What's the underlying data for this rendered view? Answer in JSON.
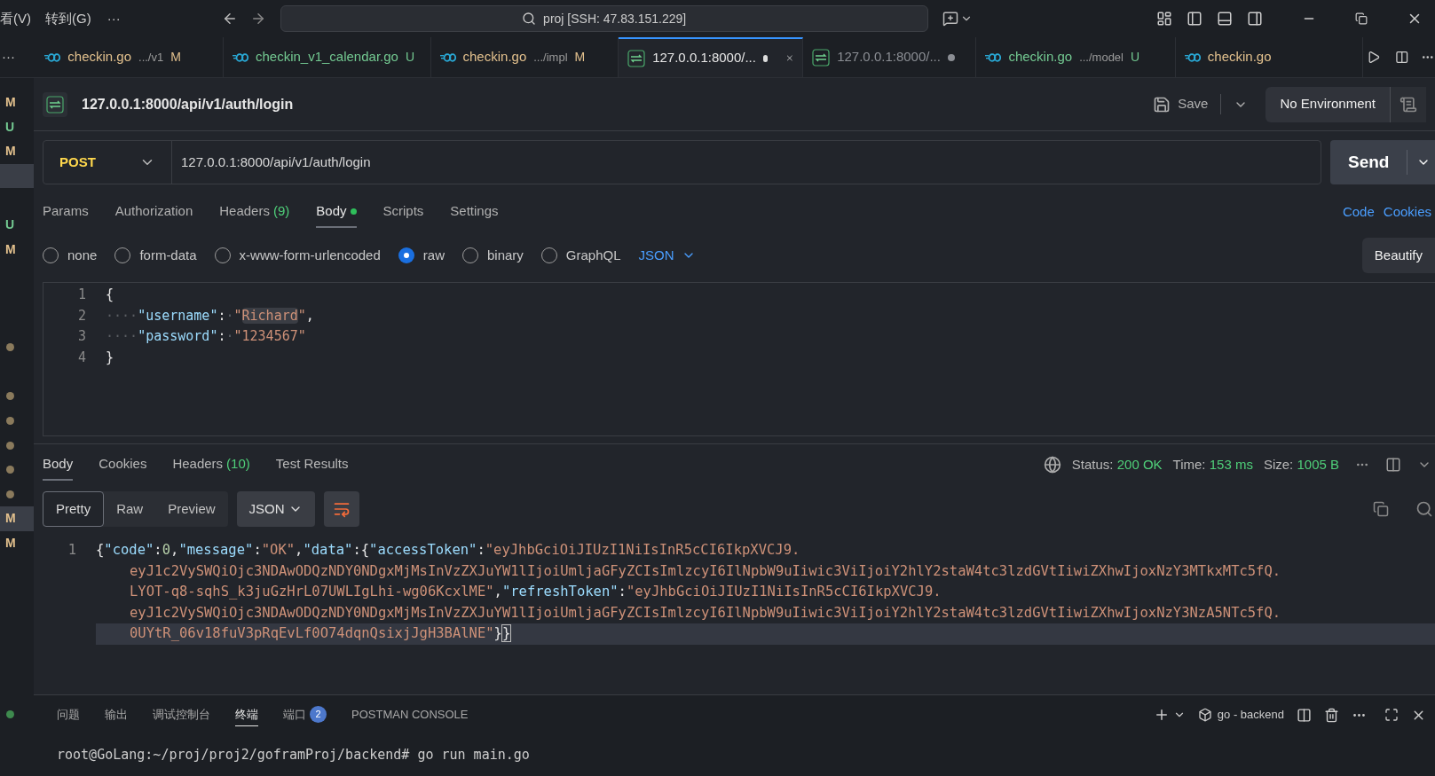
{
  "title_bar": {
    "menus": [
      "看(V)",
      "转到(G)"
    ],
    "more": "···",
    "search": "proj [SSH: 47.83.151.229]"
  },
  "editor_tabs": {
    "more": "···",
    "tabs": [
      {
        "kind": "go",
        "name": "checkin.go",
        "path": ".../v1",
        "status": "M",
        "color": "#e2c08d",
        "dirty": false,
        "selected": false
      },
      {
        "kind": "go",
        "name": "checkin_v1_calendar.go",
        "status": "U",
        "color": "#73c991",
        "dirty": false,
        "selected": false
      },
      {
        "kind": "go",
        "name": "checkin.go",
        "path": ".../impl",
        "status": "M",
        "color": "#e2c08d",
        "dirty": false,
        "selected": false
      },
      {
        "kind": "http",
        "name": "127.0.0.1:8000/...",
        "color": "#e6e6e6",
        "dirty": true,
        "selected": true
      },
      {
        "kind": "http",
        "name": "127.0.0.1:8000/...",
        "color": "#8b8e94",
        "dirty": true,
        "selected": false
      },
      {
        "kind": "go",
        "name": "checkin.go",
        "path": ".../model",
        "status": "U",
        "color": "#73c991",
        "dirty": false,
        "selected": false
      },
      {
        "kind": "go",
        "name": "checkin.go",
        "color": "#e2c08d",
        "dirty": false,
        "selected": false
      }
    ]
  },
  "gutter": [
    {
      "kind": "letter",
      "text": "M",
      "color": "#e2c08d",
      "selected": false
    },
    {
      "kind": "letter",
      "text": "U",
      "color": "#73c991",
      "selected": false
    },
    {
      "kind": "letter",
      "text": "M",
      "color": "#e2c08d",
      "selected": false
    },
    {
      "kind": "empty",
      "selected": true
    },
    {
      "kind": "empty",
      "selected": false
    },
    {
      "kind": "letter",
      "text": "U",
      "color": "#73c991",
      "selected": false
    },
    {
      "kind": "letter",
      "text": "M",
      "color": "#e2c08d",
      "selected": false
    },
    {
      "kind": "empty",
      "selected": false
    },
    {
      "kind": "empty",
      "selected": false
    },
    {
      "kind": "empty",
      "selected": false
    },
    {
      "kind": "dot",
      "color": "#8a7a5c",
      "selected": false
    },
    {
      "kind": "empty",
      "selected": false
    },
    {
      "kind": "dot",
      "color": "#8a7a5c",
      "selected": false
    },
    {
      "kind": "dot",
      "color": "#8a7a5c",
      "selected": false
    },
    {
      "kind": "dot",
      "color": "#8a7a5c",
      "selected": false
    },
    {
      "kind": "dot",
      "color": "#8a7a5c",
      "selected": false
    },
    {
      "kind": "dot",
      "color": "#8a7a5c",
      "selected": false
    },
    {
      "kind": "letter",
      "text": "M",
      "color": "#e2c08d",
      "selected": true
    },
    {
      "kind": "letter",
      "text": "M",
      "color": "#e2c08d",
      "selected": false
    },
    {
      "kind": "empty",
      "selected": false
    },
    {
      "kind": "empty",
      "selected": false
    },
    {
      "kind": "empty",
      "selected": false
    },
    {
      "kind": "empty",
      "selected": false
    },
    {
      "kind": "empty",
      "selected": false
    },
    {
      "kind": "empty",
      "selected": false
    },
    {
      "kind": "dot",
      "color": "#3e8a4e",
      "selected": false
    }
  ],
  "request": {
    "title": "127.0.0.1:8000/api/v1/auth/login",
    "save": "Save",
    "environment": "No Environment",
    "method": "POST",
    "url": "127.0.0.1:8000/api/v1/auth/login",
    "send": "Send",
    "tabs": [
      {
        "label": "Params",
        "selected": false
      },
      {
        "label": "Authorization",
        "selected": false
      },
      {
        "label": "Headers",
        "count": "(9)",
        "selected": false
      },
      {
        "label": "Body",
        "indicator": true,
        "selected": true
      },
      {
        "label": "Scripts",
        "selected": false
      },
      {
        "label": "Settings",
        "selected": false
      }
    ],
    "links": [
      "Code",
      "Cookies"
    ],
    "body_types": [
      {
        "label": "none",
        "selected": false
      },
      {
        "label": "form-data",
        "selected": false
      },
      {
        "label": "x-www-form-urlencoded",
        "selected": false
      },
      {
        "label": "raw",
        "selected": true
      },
      {
        "label": "binary",
        "selected": false
      },
      {
        "label": "GraphQL",
        "selected": false
      }
    ],
    "format": "JSON",
    "beautify": "Beautify",
    "body_lines": [
      {
        "number": "1",
        "tokens": [
          {
            "kind": "punct",
            "text": "{"
          }
        ]
      },
      {
        "number": "2",
        "tokens": [
          {
            "kind": "whitespace",
            "text": "····"
          },
          {
            "kind": "key",
            "text": "\"username\""
          },
          {
            "kind": "punct",
            "text": ":"
          },
          {
            "kind": "whitespace",
            "text": "·"
          },
          {
            "kind": "string",
            "text": "\""
          },
          {
            "kind": "highlight",
            "text": "Richard"
          },
          {
            "kind": "string",
            "text": "\""
          },
          {
            "kind": "punct",
            "text": ","
          }
        ]
      },
      {
        "number": "3",
        "tokens": [
          {
            "kind": "whitespace",
            "text": "····"
          },
          {
            "kind": "key",
            "text": "\"password\""
          },
          {
            "kind": "punct",
            "text": ":"
          },
          {
            "kind": "whitespace",
            "text": "·"
          },
          {
            "kind": "string",
            "text": "\"1234567\""
          }
        ]
      },
      {
        "number": "4",
        "tokens": [
          {
            "kind": "punct",
            "text": "}"
          }
        ]
      }
    ]
  },
  "response": {
    "tabs": [
      {
        "label": "Body",
        "selected": true
      },
      {
        "label": "Cookies",
        "selected": false
      },
      {
        "label": "Headers",
        "count": "(10)",
        "selected": false
      },
      {
        "label": "Test Results",
        "selected": false
      }
    ],
    "stats": [
      {
        "label": "Status:",
        "value": "200 OK"
      },
      {
        "label": "Time:",
        "value": "153 ms"
      },
      {
        "label": "Size:",
        "value": "1005 B"
      }
    ],
    "views": [
      {
        "label": "Pretty",
        "selected": true
      },
      {
        "label": "Raw",
        "selected": false
      },
      {
        "label": "Preview",
        "selected": false
      }
    ],
    "format": "JSON",
    "line_number": "1",
    "rows": [
      {
        "current": false,
        "tokens": [
          {
            "kind": "punct",
            "text": "{"
          },
          {
            "kind": "key",
            "text": "\"code\""
          },
          {
            "kind": "punct",
            "text": ":"
          },
          {
            "kind": "number",
            "text": "0"
          },
          {
            "kind": "punct",
            "text": ","
          },
          {
            "kind": "key",
            "text": "\"message\""
          },
          {
            "kind": "punct",
            "text": ":"
          },
          {
            "kind": "string",
            "text": "\"OK\""
          },
          {
            "kind": "punct",
            "text": ","
          },
          {
            "kind": "key",
            "text": "\"data\""
          },
          {
            "kind": "punct",
            "text": ":{"
          },
          {
            "kind": "key",
            "text": "\"accessToken\""
          },
          {
            "kind": "punct",
            "text": ":"
          },
          {
            "kind": "string",
            "text": "\"eyJhbGciOiJIUzI1NiIsInR5cCI6IkpXVCJ9."
          }
        ]
      },
      {
        "current": false,
        "tokens": [
          {
            "kind": "string",
            "text": "eyJ1c2VySWQiOjc3NDAwODQzNDY0NDgxMjMsInVzZXJuYW1lIjoiUmljaGFyZCIsImlzcyI6IlNpbW9uIiwic3ViIjoiY2hlY2staW4tc3lzdGVtIiwiZXhwIjoxNzY3MTkxMTc5fQ."
          }
        ]
      },
      {
        "current": false,
        "tokens": [
          {
            "kind": "string",
            "text": "LYOT-q8-sqhS_k3juGzHrL07UWLIgLhi-wg06KcxlME\""
          },
          {
            "kind": "punct",
            "text": ","
          },
          {
            "kind": "key",
            "text": "\"refreshToken\""
          },
          {
            "kind": "punct",
            "text": ":"
          },
          {
            "kind": "string",
            "text": "\"eyJhbGciOiJIUzI1NiIsInR5cCI6IkpXVCJ9."
          }
        ]
      },
      {
        "current": false,
        "tokens": [
          {
            "kind": "string",
            "text": "eyJ1c2VySWQiOjc3NDAwODQzNDY0NDgxMjMsInVzZXJuYW1lIjoiUmljaGFyZCIsImlzcyI6IlNpbW9uIiwic3ViIjoiY2hlY2staW4tc3lzdGVtIiwiZXhwIjoxNzY3NzA5NTc5fQ."
          }
        ]
      },
      {
        "current": true,
        "tokens": [
          {
            "kind": "string",
            "text": "0UYtR_06v18fuV3pRqEvLf0O74dqnQsixjJgH3BAlNE\""
          },
          {
            "kind": "punct",
            "text": "}"
          },
          {
            "kind": "cursor",
            "text": "}"
          }
        ]
      }
    ]
  },
  "panel": {
    "tabs": [
      {
        "label": "问题",
        "selected": false
      },
      {
        "label": "输出",
        "selected": false
      },
      {
        "label": "调试控制台",
        "selected": false
      },
      {
        "label": "终端",
        "selected": true
      },
      {
        "label": "端口",
        "badge": "2",
        "selected": false
      },
      {
        "label": "POSTMAN CONSOLE",
        "selected": false
      }
    ],
    "terminal_name": "go - backend",
    "terminal_line": "root@GoLang:~/proj/proj2/goframProj/backend# go run main.go"
  }
}
